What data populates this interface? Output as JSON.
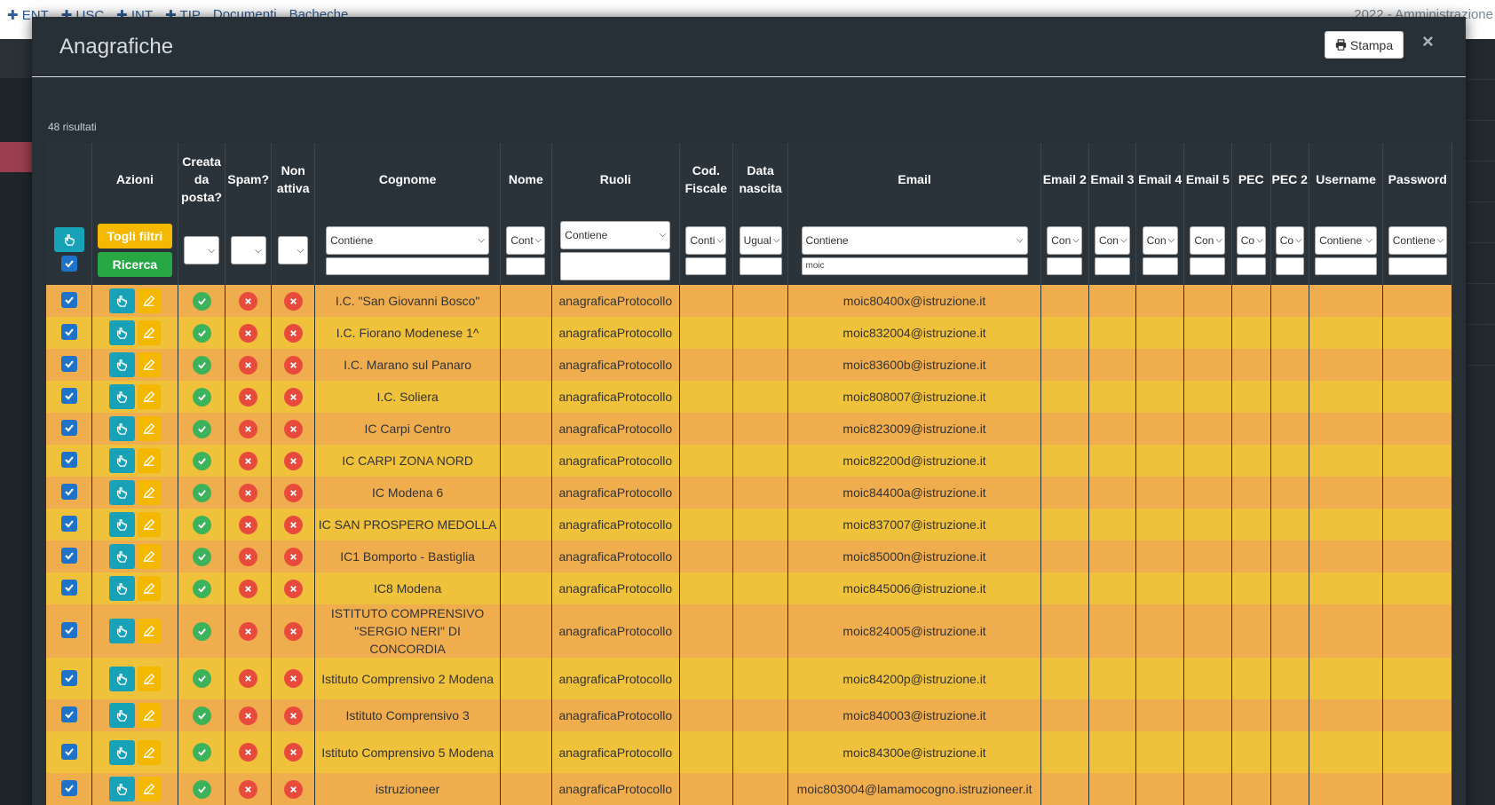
{
  "topbar": {
    "nav": [
      "✚ ENT",
      "✚ USC",
      "✚ INT",
      "✚ TIP",
      "Documenti",
      "Bacheche"
    ],
    "right": "2022 - Amministrazione"
  },
  "modal": {
    "title": "Anagrafiche",
    "print_label": "Stampa",
    "close_label": "×"
  },
  "results_text": "48 risultati",
  "columns": [
    "",
    "Azioni",
    "Creata da posta?",
    "Spam?",
    "Non attiva",
    "Cognome",
    "Nome",
    "Ruoli",
    "Cod. Fiscale",
    "Data nascita",
    "Email",
    "Email 2",
    "Email 3",
    "Email 4",
    "Email 5",
    "PEC",
    "PEC 2",
    "Username",
    "Password"
  ],
  "filters": {
    "clear_filters_label": "Togli filtri",
    "search_label": "Ricerca",
    "cognome": "Contiene",
    "nome": "Cont",
    "ruoli": "Contiene",
    "cod_fiscale": "Conti",
    "data_nascita": "Ugual",
    "email": "Contiene",
    "email_search_value": "moic",
    "email2": "Con",
    "email3": "Con",
    "email4": "Con",
    "email5": "Con",
    "pec": "Co",
    "pec2": "Co",
    "username": "Contiene",
    "password": "Contiene"
  },
  "rows": [
    {
      "cognome": "I.C. \"San Giovanni Bosco\"",
      "ruoli": "anagraficaProtocollo",
      "email": "moic80400x@istruzione.it"
    },
    {
      "cognome": "I.C. Fiorano Modenese 1^",
      "ruoli": "anagraficaProtocollo",
      "email": "moic832004@istruzione.it"
    },
    {
      "cognome": "I.C. Marano sul Panaro",
      "ruoli": "anagraficaProtocollo",
      "email": "moic83600b@istruzione.it"
    },
    {
      "cognome": "I.C. Soliera",
      "ruoli": "anagraficaProtocollo",
      "email": "moic808007@istruzione.it"
    },
    {
      "cognome": "IC Carpi Centro",
      "ruoli": "anagraficaProtocollo",
      "email": "moic823009@istruzione.it"
    },
    {
      "cognome": "IC CARPI ZONA NORD",
      "ruoli": "anagraficaProtocollo",
      "email": "moic82200d@istruzione.it"
    },
    {
      "cognome": "IC Modena 6",
      "ruoli": "anagraficaProtocollo",
      "email": "moic84400a@istruzione.it"
    },
    {
      "cognome": "IC SAN PROSPERO MEDOLLA",
      "ruoli": "anagraficaProtocollo",
      "email": "moic837007@istruzione.it"
    },
    {
      "cognome": "IC1 Bomporto - Bastiglia",
      "ruoli": "anagraficaProtocollo",
      "email": "moic85000n@istruzione.it"
    },
    {
      "cognome": "IC8 Modena",
      "ruoli": "anagraficaProtocollo",
      "email": "moic845006@istruzione.it"
    },
    {
      "cognome": "ISTITUTO COMPRENSIVO \"SERGIO NERI\" DI CONCORDIA",
      "ruoli": "anagraficaProtocollo",
      "email": "moic824005@istruzione.it"
    },
    {
      "cognome": "Istituto Comprensivo 2 Modena",
      "ruoli": "anagraficaProtocollo",
      "email": "moic84200p@istruzione.it"
    },
    {
      "cognome": "Istituto Comprensivo 3",
      "ruoli": "anagraficaProtocollo",
      "email": "moic840003@istruzione.it"
    },
    {
      "cognome": "Istituto Comprensivo 5 Modena",
      "ruoli": "anagraficaProtocollo",
      "email": "moic84300e@istruzione.it"
    },
    {
      "cognome": "istruzioneer",
      "ruoli": "anagraficaProtocollo",
      "email": "moic803004@lamamocogno.istruzioneer.it"
    }
  ]
}
